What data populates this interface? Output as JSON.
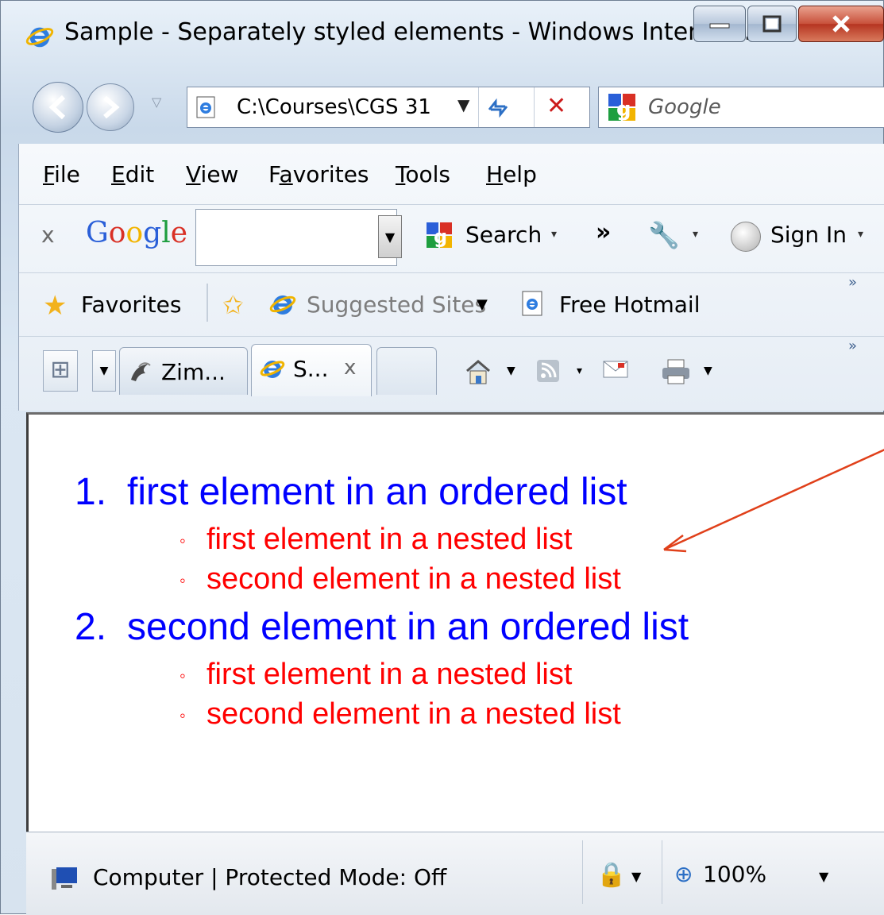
{
  "window": {
    "title": "Sample - Separately styled elements - Windows Internet...",
    "minimize_glyph": "—",
    "maximize_glyph": "▢",
    "close_glyph": "X"
  },
  "navigation": {
    "address": "C:\\Courses\\CGS 31",
    "address_dropdown_glyph": "▼",
    "refresh_glyph": "⁴⁄",
    "stop_glyph": "✕",
    "search_placeholder": "Google"
  },
  "menu": {
    "items": [
      {
        "prefix": "",
        "accel": "F",
        "rest": "ile"
      },
      {
        "prefix": "",
        "accel": "E",
        "rest": "dit"
      },
      {
        "prefix": "",
        "accel": "V",
        "rest": "iew"
      },
      {
        "prefix": "F",
        "accel": "a",
        "rest": "vorites"
      },
      {
        "prefix": "",
        "accel": "T",
        "rest": "ools"
      },
      {
        "prefix": "",
        "accel": "H",
        "rest": "elp"
      }
    ]
  },
  "google_toolbar": {
    "close_glyph": "x",
    "logo_letters": [
      "G",
      "o",
      "o",
      "g",
      "l",
      "e"
    ],
    "logo_colors": [
      "#2a5fd8",
      "#d93025",
      "#f2b400",
      "#2a5fd8",
      "#1e9e3f",
      "#d93025"
    ],
    "search_label": "Search",
    "dropdown_glyph": "▾",
    "chevron_glyph": "»",
    "sign_in_label": "Sign In"
  },
  "favorites_bar": {
    "favorites_label": "Favorites",
    "suggested_sites_label": "Suggested Sites",
    "free_hotmail_label": "Free Hotmail",
    "more_glyph": "»"
  },
  "tabs": {
    "items": [
      {
        "label": "Zim...",
        "icon": "ucf-pegasus-icon"
      },
      {
        "label": "S...",
        "icon": "ie-icon",
        "close": "x"
      }
    ],
    "more_glyph": "»"
  },
  "content": {
    "ordered_list": [
      {
        "number": "1.",
        "text": "first element in an ordered list",
        "nested": [
          "first element in a nested list",
          "second element in a nested list"
        ]
      },
      {
        "number": "2.",
        "text": "second element in an ordered list",
        "nested": [
          "first element in a nested list",
          "second element in a nested list"
        ]
      }
    ],
    "nested_bullet": "◦",
    "colors": {
      "ordered": "#0000ff",
      "nested": "#ff0000",
      "arrow": "#e0401a"
    }
  },
  "status_bar": {
    "zone_text": "Computer | Protected Mode: Off",
    "zoom_text": "100%",
    "dropdown_glyph": "▼"
  }
}
